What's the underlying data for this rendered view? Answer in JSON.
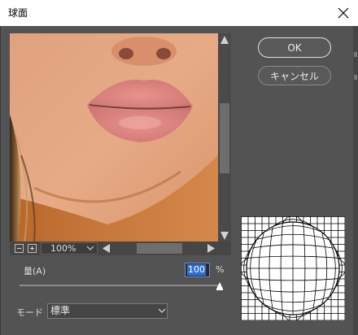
{
  "dialog": {
    "title": "球面"
  },
  "preview": {
    "zoom": "100%"
  },
  "buttons": {
    "ok": "OK",
    "cancel": "キャンセル"
  },
  "amount": {
    "label": "量(A)",
    "value": "100",
    "unit": "%",
    "level": 1.0
  },
  "mode": {
    "label": "モード",
    "value": "標準"
  },
  "colors": {
    "dialog_bg": "#535353",
    "selection": "#2f6fd1"
  }
}
